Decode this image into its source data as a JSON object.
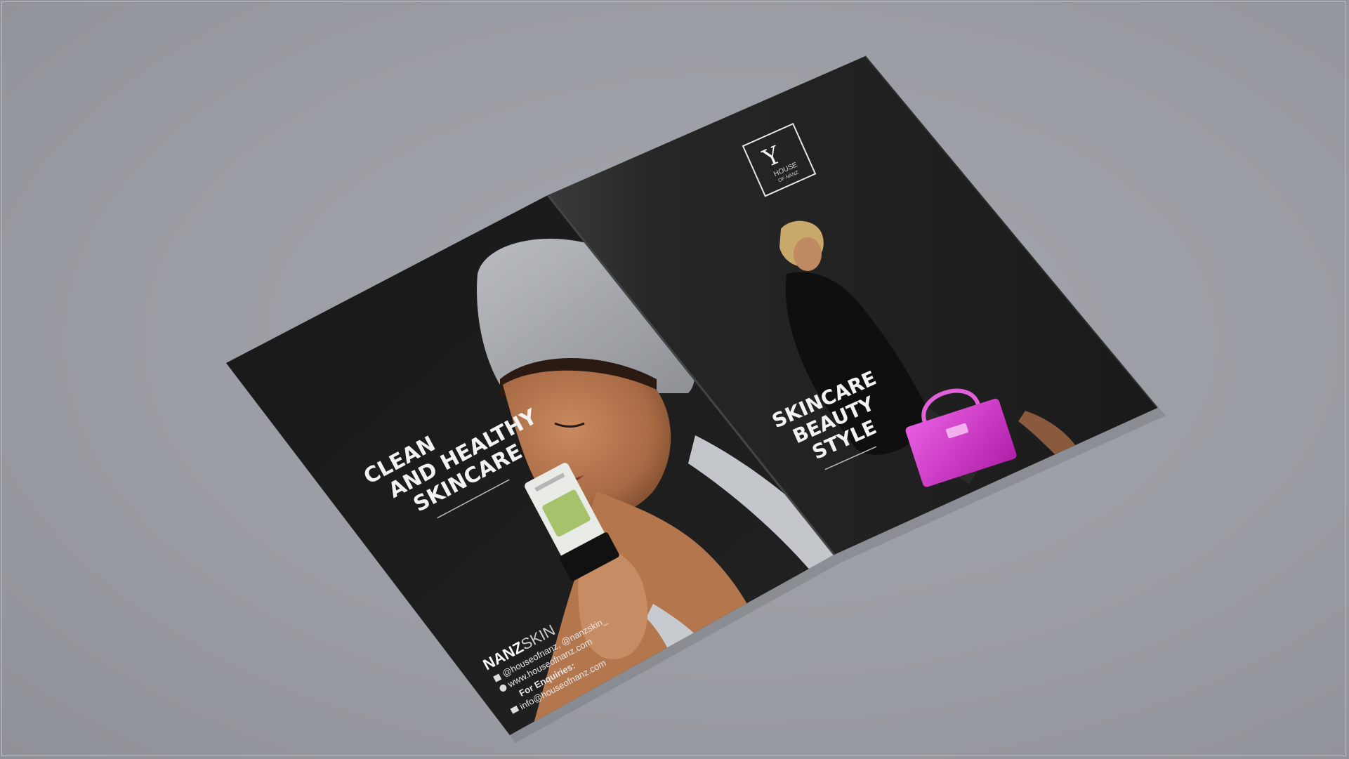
{
  "left_page": {
    "headline_lines": [
      "CLEAN",
      "AND HEALTHY",
      "SKINCARE"
    ],
    "brand": {
      "bold": "NANZ",
      "light": "SKIN"
    },
    "social_handles": "@houseofnanz, @nanzskin_",
    "website": "www.houseofnanz.com",
    "enquiries_label": "For Enquiries:",
    "email": "info@houseofnanz.com"
  },
  "right_page": {
    "logo": {
      "mark": "Y",
      "line1": "HOUSE",
      "line2": "OF NANZ"
    },
    "headline_lines": [
      "SKINCARE",
      "BEAUTY",
      "STYLE"
    ]
  },
  "colors": {
    "background": "#9b9ea4",
    "cover": "#1c1c1c",
    "bag": "#d72ed0"
  }
}
